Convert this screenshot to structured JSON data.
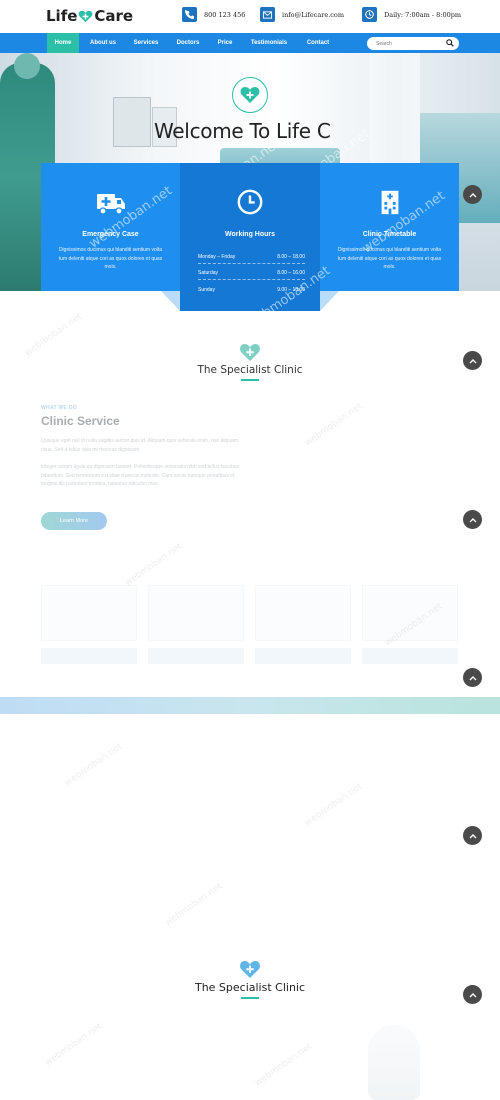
{
  "brand": {
    "name_left": "Life",
    "name_right": "Care"
  },
  "contacts": {
    "phone": "800 123 456",
    "email": "info@Lifecare.com",
    "hours": "Daily: 7:00am - 8:00pm"
  },
  "nav": {
    "items": [
      {
        "label": "Home",
        "active": true
      },
      {
        "label": "About us"
      },
      {
        "label": "Services"
      },
      {
        "label": "Doctors"
      },
      {
        "label": "Price"
      },
      {
        "label": "Testimonials"
      },
      {
        "label": "Contact"
      }
    ],
    "search_placeholder": "Search"
  },
  "hero": {
    "title": "Welcome To Life C"
  },
  "cards": {
    "emergency": {
      "title": "Emergency Case",
      "text": "Dignissimos ducimus qui blanditi sentium volta tum deleniti atque cori as quos dolores et quas mols."
    },
    "working": {
      "title": "Working Hours",
      "rows": [
        {
          "day": "Monday – Friday",
          "time": "8.00 – 18.00"
        },
        {
          "day": "Saturday",
          "time": "8.00 – 16.00"
        },
        {
          "day": "Sunday",
          "time": "9.00 – 13.00"
        }
      ]
    },
    "timetable": {
      "title": "Clinic Timetable",
      "text": "Dignissimos ducimus qui blanditi sentium volta tum deleniti atque cori as quos dolores et quas mols."
    }
  },
  "specialist": {
    "title": "The Specialist Clinic"
  },
  "service": {
    "eyebrow": "WHAT WE DO",
    "title": "Clinic Service",
    "para1": "Quisque eget nisl id nulla sagittis auctor quis id. Aliquam quis vehicula enim, non aliquam risus. Sed a tellus quis mi rhoncus dignissim.",
    "para2": "Integer rutrum ligula eu dignissim laoreet. Pellentesque venenatis nibh sed tellus faucibus bibendum. Sed fermentum est vitae rhoncus molestie. Cum sociis natoque penatibus et magnis dis parturient montes, nascetur ridiculus mus.",
    "button": "Learn More"
  },
  "specialist2": {
    "title": "The Specialist Clinic"
  },
  "watermark": "webmoban.net",
  "colors": {
    "primary": "#1d87e4",
    "accent": "#2cbfa8",
    "dark_card": "#1478d4"
  }
}
